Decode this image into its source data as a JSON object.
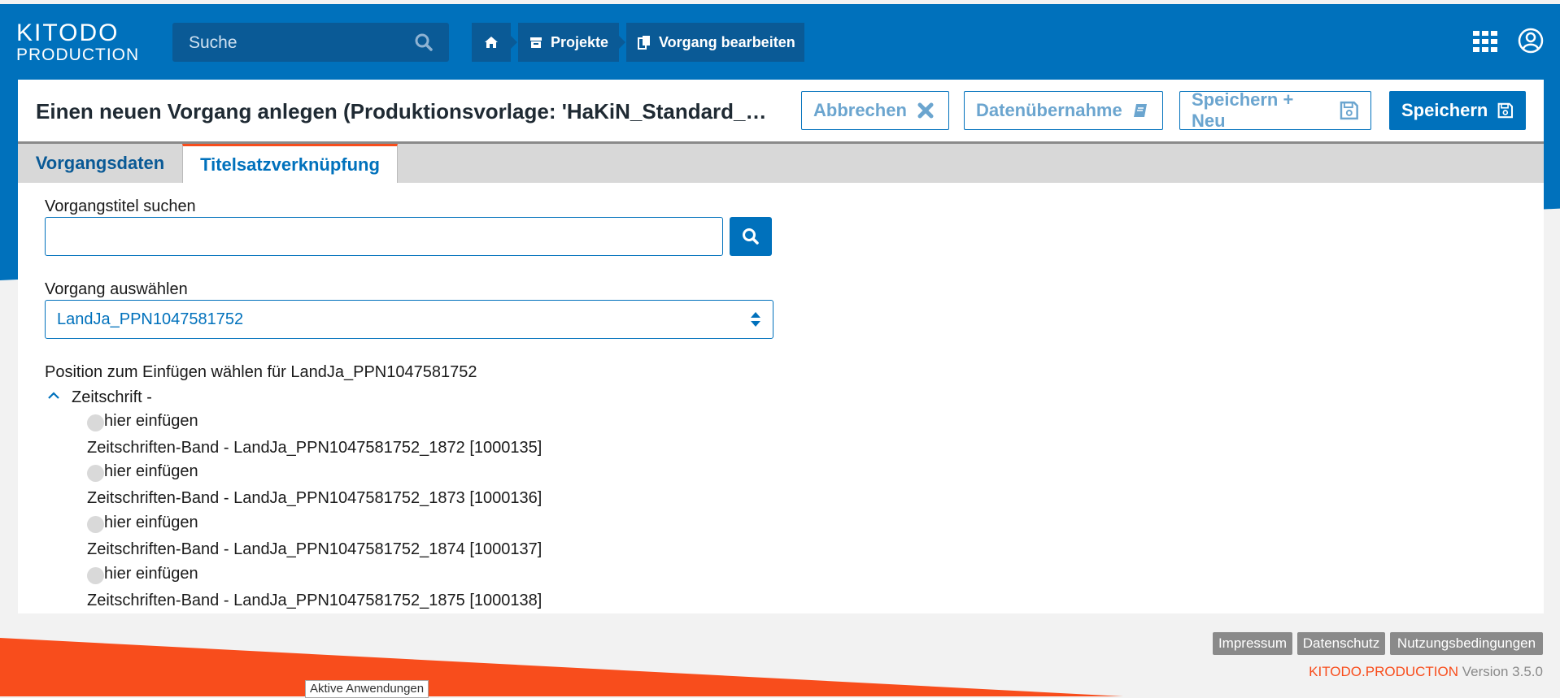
{
  "header": {
    "logo_line1": "KITODO",
    "logo_line2": "PRODUCTION",
    "search_placeholder": "Suche",
    "breadcrumbs": [
      {
        "label": "",
        "icon": "home-icon"
      },
      {
        "label": "Projekte",
        "icon": "archive-icon"
      },
      {
        "label": "Vorgang bearbeiten",
        "icon": "copy-icon"
      }
    ],
    "apps_icon": "apps-grid-icon",
    "user_icon": "user-circle-icon"
  },
  "page": {
    "title": "Einen neuen Vorgang anlegen (Produktionsvorlage: 'HaKiN_Standard_Digitalisierung')",
    "buttons": {
      "cancel": "Abbrechen",
      "data_import": "Datenübernahme",
      "save_new": "Speichern + Neu",
      "save": "Speichern"
    },
    "tabs": [
      "Vorgangsdaten",
      "Titelsatzverknüpfung"
    ],
    "active_tab": "Titelsatzverknüpfung"
  },
  "form": {
    "search_label": "Vorgangstitel suchen",
    "search_value": "",
    "select_label": "Vorgang auswählen",
    "select_value": "LandJa_PPN1047581752",
    "position_label": "Position zum Einfügen wählen für LandJa_PPN1047581752",
    "tree_root": "Zeitschrift -",
    "insert_label": "hier einfügen",
    "nodes": [
      "Zeitschriften-Band - LandJa_PPN1047581752_1872 [1000135]",
      "Zeitschriften-Band - LandJa_PPN1047581752_1873 [1000136]",
      "Zeitschriften-Band - LandJa_PPN1047581752_1874 [1000137]",
      "Zeitschriften-Band - LandJa_PPN1047581752_1875 [1000138]"
    ]
  },
  "footer": {
    "links": [
      "Impressum",
      "Datenschutz",
      "Nutzungsbedingungen"
    ],
    "brand": "KITODO.PRODUCTION",
    "version": "Version 3.5.0",
    "tooltip": "Aktive Anwendungen"
  },
  "colors": {
    "primary": "#0071bc",
    "accent": "#f84d1c",
    "dark_blue": "#0a5a96"
  }
}
